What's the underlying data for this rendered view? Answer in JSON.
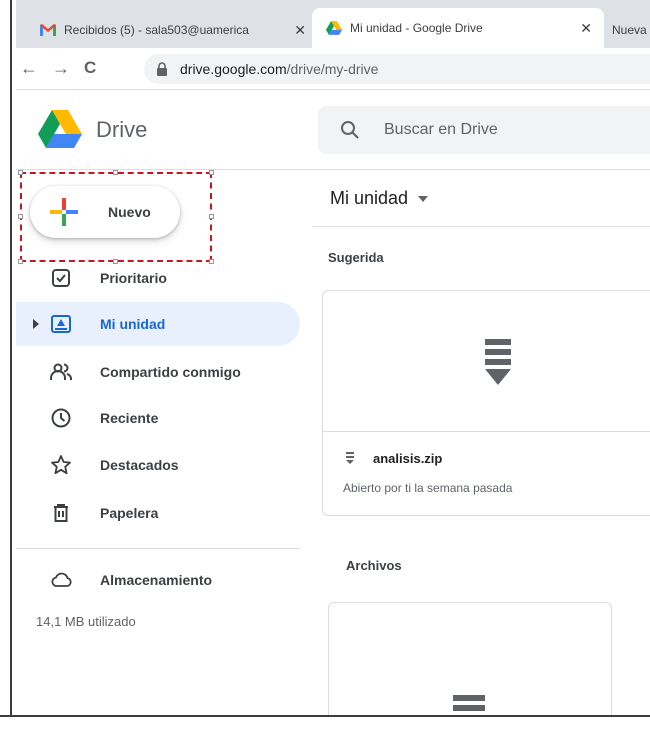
{
  "browser": {
    "tabs": [
      {
        "title": "Recibidos (5) - sala503@uamerica",
        "icon": "gmail-icon",
        "close": "✕"
      },
      {
        "title": "Mi unidad - Google Drive",
        "icon": "drive-icon",
        "close": "✕"
      },
      {
        "title": "Nueva p",
        "icon": ""
      }
    ],
    "url_host": "drive.google.com",
    "url_path": "/drive/my-drive",
    "back": "←",
    "forward": "→",
    "reload": "C"
  },
  "header": {
    "app_name": "Drive",
    "search_placeholder": "Buscar en Drive"
  },
  "sidebar": {
    "new_label": "Nuevo",
    "items": [
      {
        "label": "Prioritario",
        "icon": "priority-checkbox-icon"
      },
      {
        "label": "Mi unidad",
        "icon": "my-drive-icon",
        "active": true
      },
      {
        "label": "Compartido conmigo",
        "icon": "shared-people-icon"
      },
      {
        "label": "Reciente",
        "icon": "clock-icon"
      },
      {
        "label": "Destacados",
        "icon": "star-icon"
      },
      {
        "label": "Papelera",
        "icon": "trash-icon"
      }
    ],
    "storage_label": "Almacenamiento",
    "storage_used": "14,1 MB utilizado"
  },
  "main": {
    "title": "Mi unidad",
    "suggested_label": "Sugerida",
    "suggested_file": {
      "name": "analisis.zip",
      "subtitle": "Abierto por ti la semana pasada"
    },
    "files_label": "Archivos"
  },
  "colors": {
    "accent_blue": "#1967d2",
    "active_bg": "#e8f0fe",
    "selection_red": "#c4161c"
  }
}
